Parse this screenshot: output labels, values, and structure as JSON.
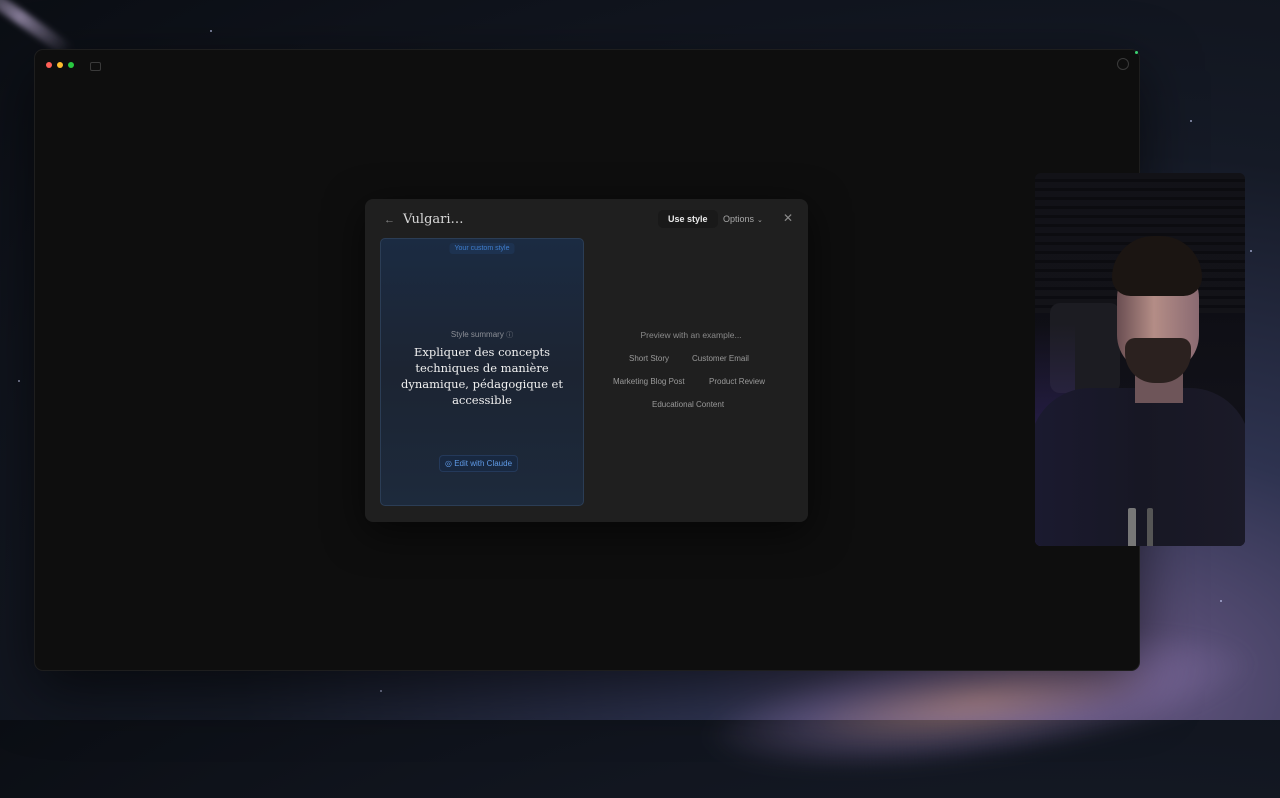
{
  "window": {
    "traffic_colors": [
      "#ff5f57",
      "#febc2e",
      "#28c840"
    ]
  },
  "modal": {
    "title": "Vulgari…",
    "use_style_label": "Use style",
    "options_label": "Options",
    "style_card": {
      "badge": "Your custom style",
      "summary_label": "Style summary",
      "summary_text": "Expliquer des concepts techniques de manière dynamique, pédagogique et accessible",
      "edit_button_label": "Edit with Claude"
    },
    "preview": {
      "label": "Preview with an example...",
      "examples": [
        "Short Story",
        "Customer Email",
        "Marketing Blog Post",
        "Product Review",
        "Educational Content"
      ]
    }
  },
  "colors": {
    "accent_blue": "#3f7fd0",
    "modal_bg": "#1f1f1f",
    "window_bg": "#0e0e0e"
  }
}
